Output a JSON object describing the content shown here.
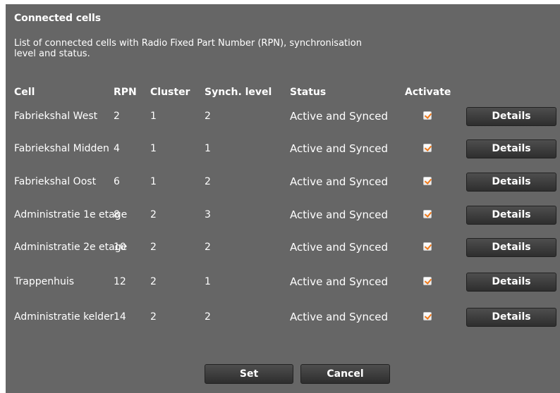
{
  "section": {
    "title": "Connected cells",
    "description": "List of connected cells with Radio Fixed Part Number (RPN), synchronisation level and status."
  },
  "table": {
    "headers": {
      "cell": "Cell",
      "rpn": "RPN",
      "cluster": "Cluster",
      "synch": "Synch. level",
      "status": "Status",
      "activate": "Activate"
    },
    "rows": [
      {
        "cell": "Fabriekshal West",
        "rpn": "2",
        "cluster": "1",
        "synch": "2",
        "status": "Active and Synced",
        "activated": true,
        "action": "Details"
      },
      {
        "cell": "Fabriekshal Midden",
        "rpn": "4",
        "cluster": "1",
        "synch": "1",
        "status": "Active and Synced",
        "activated": true,
        "action": "Details"
      },
      {
        "cell": "Fabriekshal Oost",
        "rpn": "6",
        "cluster": "1",
        "synch": "2",
        "status": "Active and Synced",
        "activated": true,
        "action": "Details"
      },
      {
        "cell": "Administratie 1e etage",
        "rpn": "8",
        "cluster": "2",
        "synch": "3",
        "status": "Active and Synced",
        "activated": true,
        "action": "Details"
      },
      {
        "cell": "Administratie 2e etage",
        "rpn": "10",
        "cluster": "2",
        "synch": "2",
        "status": "Active and Synced",
        "activated": true,
        "action": "Details"
      },
      {
        "cell": "Trappenhuis",
        "rpn": "12",
        "cluster": "2",
        "synch": "1",
        "status": "Active and Synced",
        "activated": true,
        "action": "Details"
      },
      {
        "cell": "Administratie kelder",
        "rpn": "14",
        "cluster": "2",
        "synch": "2",
        "status": "Active and Synced",
        "activated": true,
        "action": "Details"
      }
    ]
  },
  "actions": {
    "set_label": "Set",
    "cancel_label": "Cancel"
  },
  "colors": {
    "panel_background": "#666666",
    "checkmark": "#f07818",
    "button_background": "#3a3a3a"
  },
  "icons": {
    "checkbox": "checkbox-checked-icon"
  }
}
